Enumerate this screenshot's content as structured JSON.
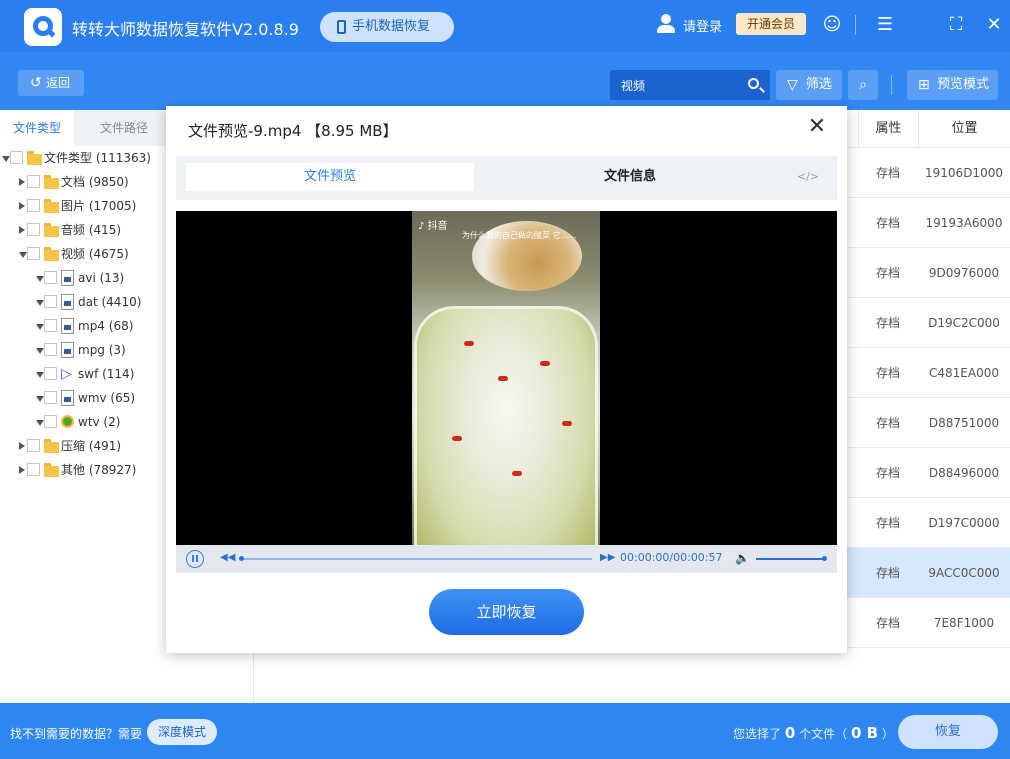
{
  "app": {
    "title": "转转大师数据恢复软件V2.0.8.9",
    "phone_recovery": "手机数据恢复",
    "login": "请登录",
    "vip": "开通会员"
  },
  "toolbar": {
    "back": "返回",
    "search_value": "视频",
    "filter": "筛选",
    "preview_mode": "预览模式"
  },
  "sidebar": {
    "tabs": [
      "文件类型",
      "文件路径"
    ],
    "tree": [
      {
        "label": "文件类型 (111363)",
        "level": 0,
        "expanded": true,
        "icon": "folder-icon"
      },
      {
        "label": "文档 (9850)",
        "level": 1,
        "expanded": false,
        "icon": "folder-icon"
      },
      {
        "label": "图片 (17005)",
        "level": 1,
        "expanded": false,
        "icon": "folder-icon"
      },
      {
        "label": "音频 (415)",
        "level": 1,
        "expanded": false,
        "icon": "folder-icon"
      },
      {
        "label": "视频 (4675)",
        "level": 1,
        "expanded": true,
        "icon": "folder-icon"
      },
      {
        "label": "avi (13)",
        "level": 2,
        "expanded": true,
        "icon": "video-file-icon"
      },
      {
        "label": "dat (4410)",
        "level": 2,
        "expanded": true,
        "icon": "video-file-icon"
      },
      {
        "label": "mp4 (68)",
        "level": 2,
        "expanded": true,
        "icon": "video-file-icon"
      },
      {
        "label": "mpg (3)",
        "level": 2,
        "expanded": true,
        "icon": "video-file-icon"
      },
      {
        "label": "swf (114)",
        "level": 2,
        "expanded": true,
        "icon": "flash-file-icon"
      },
      {
        "label": "wmv (65)",
        "level": 2,
        "expanded": true,
        "icon": "video-file-icon"
      },
      {
        "label": "wtv (2)",
        "level": 2,
        "expanded": true,
        "icon": "media-file-icon"
      },
      {
        "label": "压缩 (491)",
        "level": 1,
        "expanded": false,
        "icon": "folder-icon"
      },
      {
        "label": "其他 (78927)",
        "level": 1,
        "expanded": false,
        "icon": "folder-icon"
      }
    ]
  },
  "table": {
    "headers": [
      "属性",
      "位置"
    ],
    "rows": [
      {
        "attr": "存档",
        "location": "19106D1000"
      },
      {
        "attr": "存档",
        "location": "19193A6000"
      },
      {
        "attr": "存档",
        "location": "9D0976000"
      },
      {
        "attr": "存档",
        "location": "D19C2C000"
      },
      {
        "attr": "存档",
        "location": "C481EA000"
      },
      {
        "attr": "存档",
        "location": "D88751000"
      },
      {
        "attr": "存档",
        "location": "D88496000"
      },
      {
        "attr": "存档",
        "location": "D197C0000"
      },
      {
        "attr": "存档",
        "location": "9ACC0C000",
        "selected": true
      },
      {
        "attr": "存档",
        "location": "7E8F1000"
      }
    ]
  },
  "modal": {
    "title": "文件预览-9.mp4 【8.95 MB】",
    "tab_preview": "文件预览",
    "tab_info": "文件信息",
    "tab_code": "</>",
    "video_brand": "抖音",
    "video_caption": "为什么我的自己做的酸菜 它……",
    "time": "00:00:00/00:00:57",
    "recover_now": "立即恢复"
  },
  "footer": {
    "prompt": "找不到需要的数据？需要",
    "deep_mode": "深度模式",
    "selected_prefix": "您选择了",
    "selected_count": "0",
    "selected_mid": "个文件（",
    "selected_size": "0 B",
    "selected_suffix": "）",
    "recover": "恢复"
  }
}
